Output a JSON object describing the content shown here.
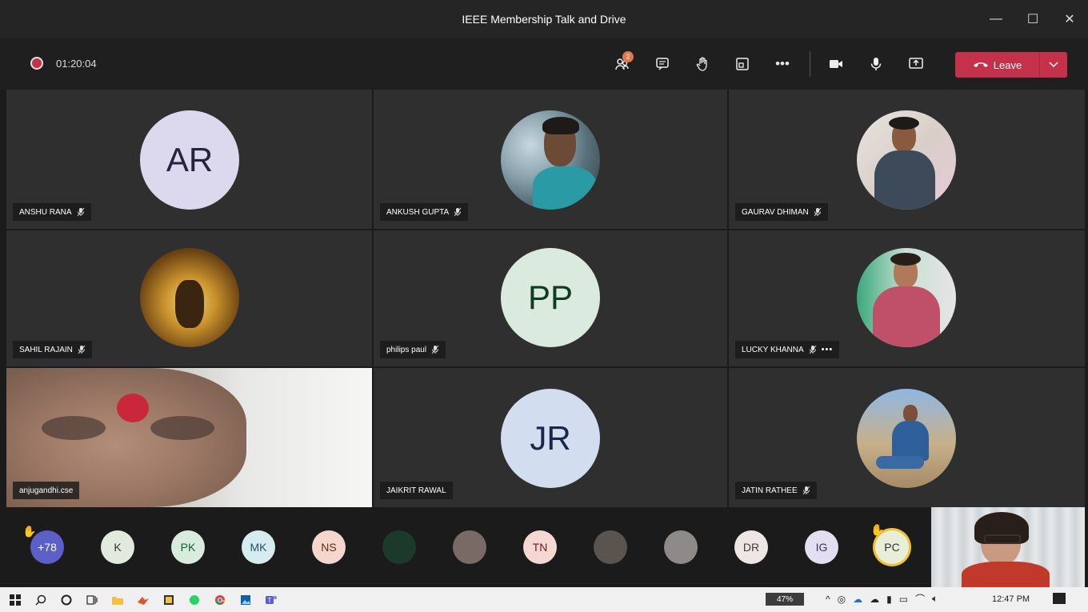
{
  "window": {
    "title": "IEEE Membership Talk and Drive",
    "minimize": "—",
    "maximize": "☐",
    "close": "✕"
  },
  "toolbar": {
    "timer": "01:20:04",
    "participants_badge": "2",
    "more": "•••",
    "leave_label": "Leave"
  },
  "tiles": [
    {
      "name": "ANSHU RANA",
      "initials": "AR",
      "color": "#dcd9ee",
      "text_color": "#24243f"
    },
    {
      "name": "ANKUSH GUPTA"
    },
    {
      "name": "GAURAV DHIMAN"
    },
    {
      "name": "SAHIL RAJAIN"
    },
    {
      "name": "philips paul",
      "initials": "PP",
      "color": "#dbeadf",
      "text_color": "#0f3b22"
    },
    {
      "name": "LUCKY KHANNA",
      "more": "•••"
    },
    {
      "name": "anjugandhi.cse"
    },
    {
      "name": "JAIKRIT RAWAL",
      "initials": "JR",
      "color": "#d3ddf0",
      "text_color": "#18274a"
    },
    {
      "name": "JATIN RATHEE"
    }
  ],
  "strip": [
    {
      "label": "+78",
      "color": "#5b5fc7",
      "text_color": "#ffffff"
    },
    {
      "label": "K",
      "color": "#e1eadc",
      "text_color": "#333333"
    },
    {
      "label": "PK",
      "color": "#d8ecdd",
      "text_color": "#1c5a32"
    },
    {
      "label": "MK",
      "color": "#d7ecf0",
      "text_color": "#1f5663"
    },
    {
      "label": "NS",
      "color": "#f5d6cc",
      "text_color": "#6a2a17"
    },
    {
      "label": "",
      "color": "#1c3a2a"
    },
    {
      "label": "",
      "color": "#7a6a66"
    },
    {
      "label": "TN",
      "color": "#f7d7d2",
      "text_color": "#6a1f1f"
    },
    {
      "label": "",
      "color": "#5a5450"
    },
    {
      "label": "",
      "color": "#8e8a88"
    },
    {
      "label": "DR",
      "color": "#eee6e4",
      "text_color": "#4a3a3a"
    },
    {
      "label": "IG",
      "color": "#e3dff0",
      "text_color": "#3b3360"
    },
    {
      "label": "PC",
      "color": "#e7efd9",
      "text_color": "#333333"
    }
  ],
  "taskbar": {
    "battery": "47%",
    "time": "12:47 PM"
  },
  "colors": {
    "leave": "#c4314b",
    "badge": "#e2774a",
    "raised_hand": "#f1c232"
  }
}
